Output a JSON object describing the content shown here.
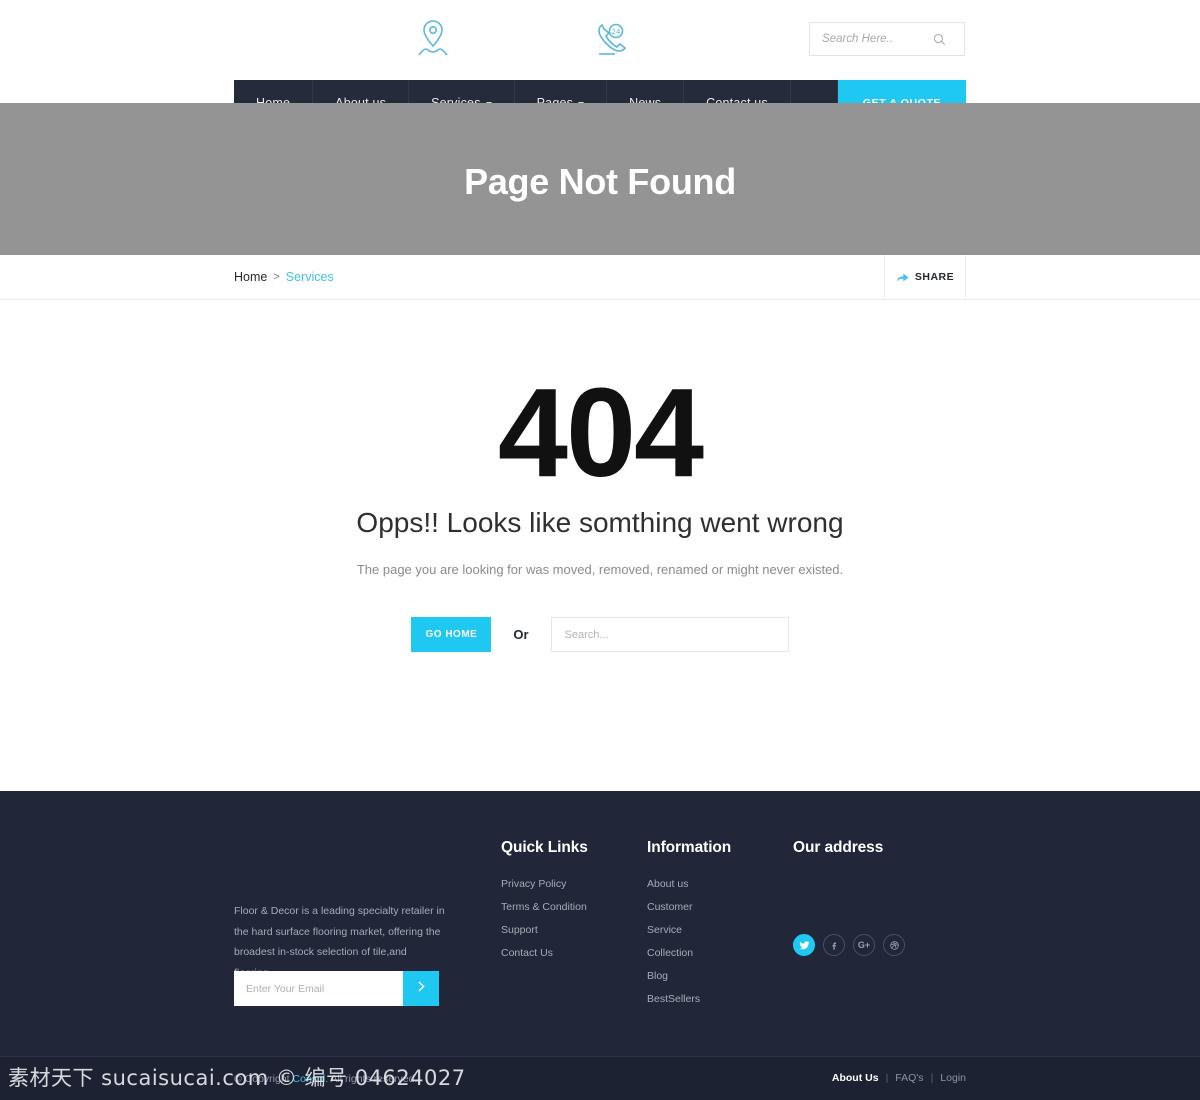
{
  "header": {
    "logo_pin_icon": "location-pin-icon",
    "logo_phone_icon": "phone-24h-icon",
    "search": {
      "placeholder": "Search Here..",
      "value": "",
      "icon": "search-icon"
    }
  },
  "nav": {
    "items": [
      {
        "label": "Home",
        "has_caret": false
      },
      {
        "label": "About us",
        "has_caret": false
      },
      {
        "label": "Services",
        "has_caret": true
      },
      {
        "label": "Pages",
        "has_caret": true
      },
      {
        "label": "News",
        "has_caret": false
      },
      {
        "label": "Contact us",
        "has_caret": false
      }
    ],
    "cta_label": "GET A QUOTE"
  },
  "banner": {
    "title": "Page Not Found",
    "bg_color": "#949494"
  },
  "breadcrumb": {
    "home": "Home",
    "separator": ">",
    "current": "Services",
    "share_label": "SHARE",
    "share_icon": "share-arrow-icon"
  },
  "error": {
    "code": "404",
    "heading": "Opps!! Looks like somthing went wrong",
    "description": "The page you are looking for was moved, removed, renamed or might never existed.",
    "go_home_label": "GO HOME",
    "or_label": "Or",
    "search_placeholder": "Search...",
    "search_value": ""
  },
  "footer": {
    "about_text": "Floor & Decor is a leading specialty retailer in the hard surface flooring market, offering the broadest in-stock selection of tile,and flooring.",
    "newsletter": {
      "placeholder": "Enter Your Email",
      "value": "",
      "submit_icon": "chevron-right-icon"
    },
    "columns": [
      {
        "title": "Quick Links",
        "links": [
          "Privacy Policy",
          "Terms & Condition",
          "Support",
          "Contact Us"
        ]
      },
      {
        "title": "Information",
        "links": [
          "About us",
          "Customer",
          "Service",
          "Collection",
          "Blog",
          "BestSellers"
        ]
      },
      {
        "title": "Our address",
        "links": []
      }
    ],
    "socials": [
      {
        "name": "twitter-icon",
        "active": true
      },
      {
        "name": "facebook-icon",
        "active": false
      },
      {
        "name": "google-plus-icon",
        "active": false
      },
      {
        "name": "dribbble-icon",
        "active": false
      }
    ]
  },
  "bottom": {
    "copyright_prefix": "© Copyright ",
    "copyright_brand": "Consul",
    "copyright_suffix": ". All rights reserved.",
    "links": [
      {
        "label": "About Us",
        "active": true
      },
      {
        "label": "FAQ's",
        "active": false
      },
      {
        "label": "Login",
        "active": false
      }
    ],
    "divider": "|"
  },
  "watermark": {
    "text": "素材天下 sucaisucai.com © 编号 04624027"
  },
  "colors": {
    "accent": "#1ec8f0",
    "dark": "#252b3a",
    "footer": "#212738",
    "bottom": "#1c2231",
    "banner": "#949494"
  }
}
